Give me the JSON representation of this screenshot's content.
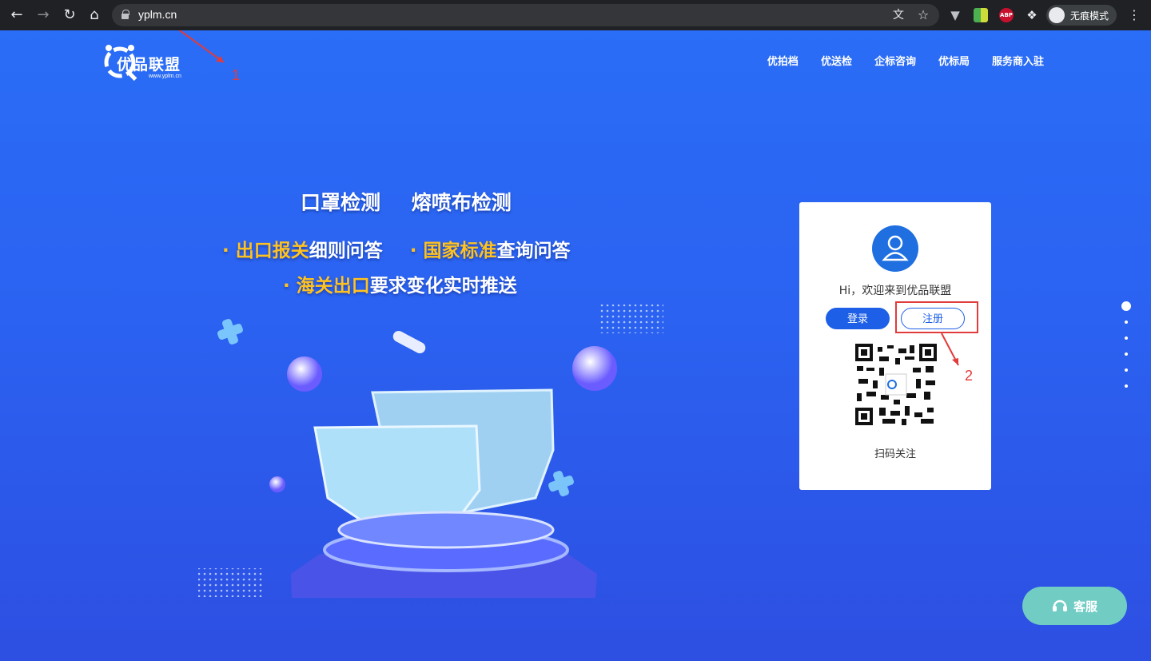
{
  "browser": {
    "url": "yplm.cn",
    "incognito_label": "无痕模式",
    "back_icon": "arrow-left-icon",
    "forward_icon": "arrow-right-icon",
    "reload_icon": "reload-icon",
    "home_icon": "home-icon",
    "ext_abp_label": "ABP"
  },
  "site": {
    "logo_text": "优品联盟",
    "logo_url": "www.yplm.cn",
    "nav": [
      "优拍档",
      "优送检",
      "企标咨询",
      "优标局",
      "服务商入驻"
    ]
  },
  "hero": {
    "line1": "口罩检测 熔喷布检测",
    "line2_y1": "· 出口报关",
    "line2_w1": "细则问答",
    "line2_y2": "· 国家标准",
    "line2_w2": "查询问答",
    "line3_y": "· 海关出口",
    "line3_w": "要求变化实时推送"
  },
  "card": {
    "welcome": "Hi，欢迎来到优品联盟",
    "login_label": "登录",
    "register_label": "注册",
    "scan_label": "扫码关注"
  },
  "annotations": {
    "a1": "1",
    "a2": "2"
  },
  "pager": {
    "count": 6,
    "active": 0
  },
  "kefu_label": "客服",
  "colors": {
    "primary": "#1d5fe6",
    "accent_yellow": "#ffc21f",
    "annotation": "#e23b3b",
    "kefu": "#71ccc4"
  }
}
